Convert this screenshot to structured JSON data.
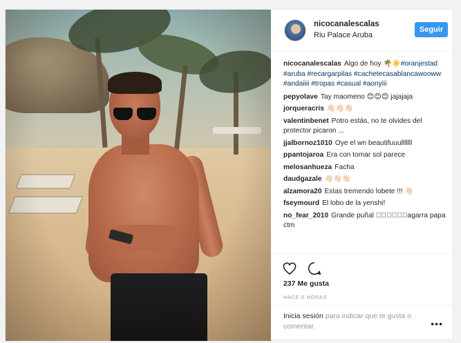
{
  "post": {
    "username": "nicocanalescalas",
    "location": "Riu Palace Aruba",
    "follow_label": "Seguir",
    "likes": "237 Me gusta",
    "time": "HACE 9 HORAS",
    "login_link": "Inicia sesión",
    "login_rest": " para indicar que te gusta o comentar.",
    "more_label": "•••"
  },
  "caption": {
    "user": "nicocanalescalas",
    "text": "Algo de hoy 🌴☀️",
    "tags": "#oranjestad #aruba #recargarpilas #cachetecasablancawooww #andaiiii #tropas #casual #aonyiii"
  },
  "comments": [
    {
      "user": "pepyolave",
      "text": "Tay maomeno 😊😊😊 jajajaja"
    },
    {
      "user": "jorqueracris",
      "text": "👋🏻👋🏻👋🏻"
    },
    {
      "user": "valentinbenet",
      "text": "Potro estás, no te olvides del protector picaron ..."
    },
    {
      "user": "jjalbornoz1010",
      "text": "Oye el wn beautifuuulllllll"
    },
    {
      "user": "ppantojaroa",
      "text": "Era con tomar sol parece"
    },
    {
      "user": "melosanhueza",
      "text": "Facha"
    },
    {
      "user": "daudgazale",
      "text": "👋🏻👋🏻👋🏻"
    },
    {
      "user": "alzamora20",
      "text": "Estas tremendo lobete !!! 👋🏻"
    },
    {
      "user": "fseymourd",
      "text": "El lobo de la yenshi!"
    },
    {
      "user": "no_fear_2010",
      "text": "Grande puñal ⃞⃞⃞⃞⃞⃞agarra papa ctm"
    }
  ],
  "icons": {
    "like": "heart-icon",
    "comment": "comment-icon",
    "more": "more-options-icon"
  },
  "colors": {
    "follow_button": "#3897f0",
    "hashtag": "#003569"
  }
}
